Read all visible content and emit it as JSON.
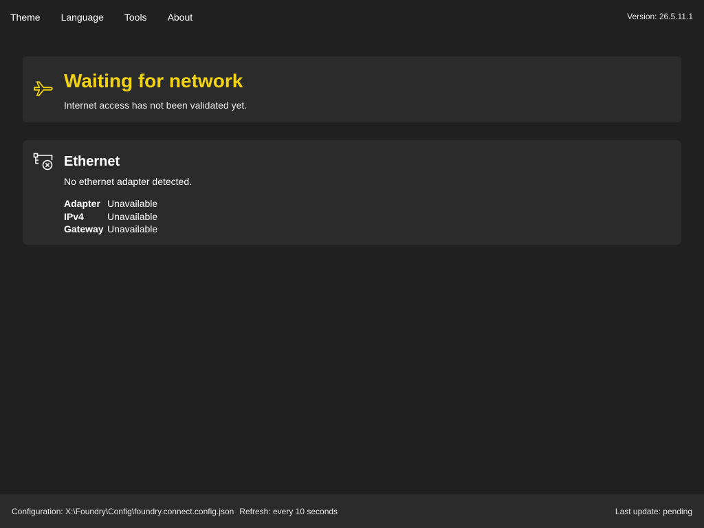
{
  "menu": {
    "items": [
      {
        "label": "Theme"
      },
      {
        "label": "Language"
      },
      {
        "label": "Tools"
      },
      {
        "label": "About"
      }
    ],
    "version": "Version: 26.5.11.1"
  },
  "status_card": {
    "icon": "airplane-icon",
    "title": "Waiting for network",
    "subtitle": "Internet access has not been validated yet.",
    "accent_color": "#f2d313"
  },
  "ethernet_card": {
    "icon": "network-disconnected-icon",
    "title": "Ethernet",
    "subtitle": "No ethernet adapter detected.",
    "details": [
      {
        "key": "Adapter",
        "value": "Unavailable"
      },
      {
        "key": "IPv4",
        "value": "Unavailable"
      },
      {
        "key": "Gateway",
        "value": "Unavailable"
      }
    ]
  },
  "footer": {
    "configuration": "Configuration: X:\\Foundry\\Config\\foundry.connect.config.json",
    "refresh": "Refresh: every 10 seconds",
    "last_update": "Last update: pending"
  }
}
